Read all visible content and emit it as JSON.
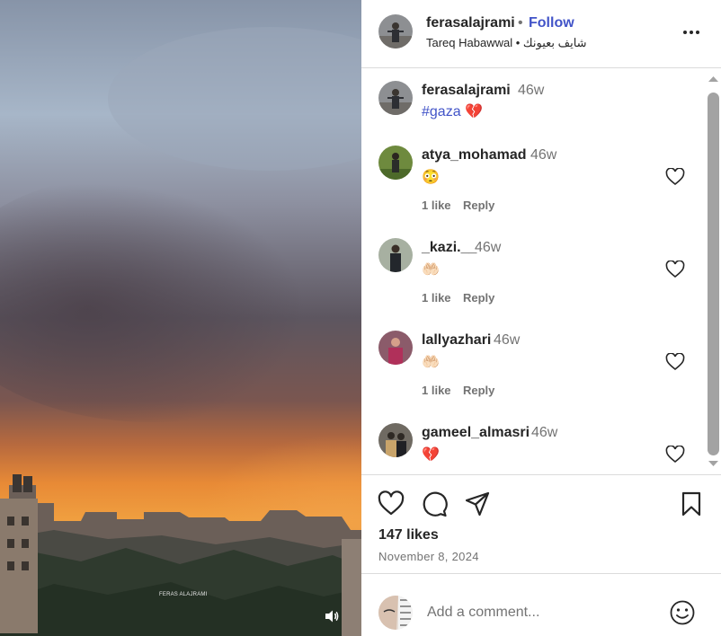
{
  "media": {
    "watermark": "FERAS ALAJRAMI",
    "sound_icon": "volume-icon"
  },
  "post": {
    "author": "ferasalajrami",
    "separator": "•",
    "follow_label": "Follow",
    "audio_artist": "Tareq Habawwal",
    "audio_separator": "•",
    "audio_title": "شايف بعيونك",
    "more_icon": "more-options-icon",
    "caption": {
      "username": "ferasalajrami",
      "time": "46w",
      "hashtag": "#gaza",
      "emoji": "💔"
    }
  },
  "comments": [
    {
      "username": "atya_mohamad",
      "time": "46w",
      "text": "😳",
      "likes": "1 like",
      "reply": "Reply"
    },
    {
      "username": "_kazi.__",
      "time": "46w",
      "text": "🤲🏻",
      "likes": "1 like",
      "reply": "Reply"
    },
    {
      "username": "lallyazhari",
      "time": "46w",
      "text": "🤲🏻",
      "likes": "1 like",
      "reply": "Reply"
    },
    {
      "username": "gameel_almasri",
      "time": "46w",
      "text": "💔"
    }
  ],
  "actions": {
    "icons": [
      "heart-icon",
      "comment-icon",
      "share-icon",
      "bookmark-icon"
    ],
    "likes": "147 likes",
    "date": "November 8, 2024"
  },
  "add_comment": {
    "placeholder": "Add a comment...",
    "emoji_icon": "smiley-icon"
  },
  "colors": {
    "link": "#4254c8",
    "text": "#262626",
    "secondary": "#737373",
    "divider": "#dbdbdb"
  }
}
